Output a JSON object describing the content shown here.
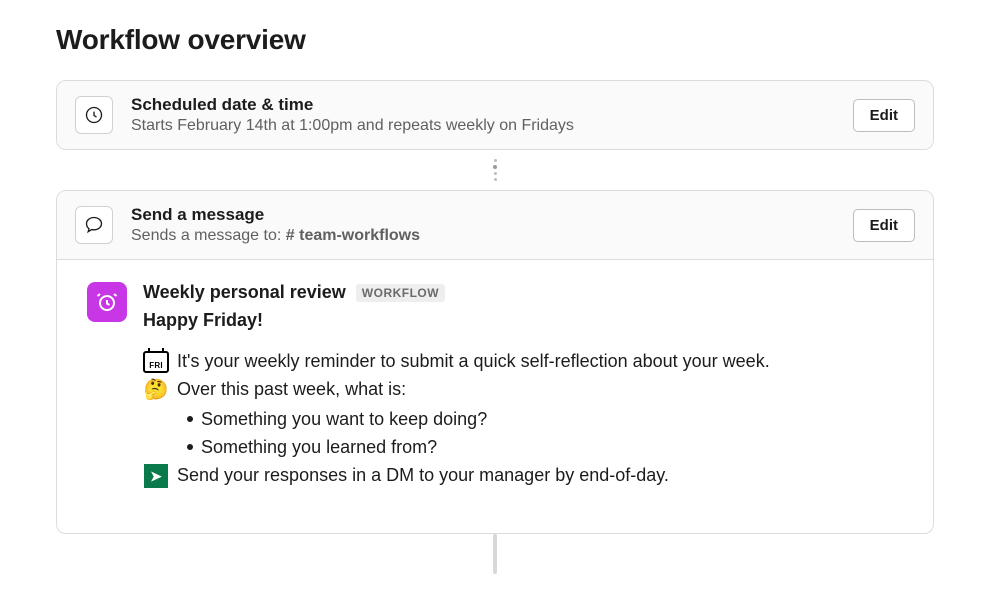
{
  "title": "Workflow overview",
  "steps": {
    "schedule": {
      "title": "Scheduled date & time",
      "subtitle": "Starts February 14th at 1:00pm and repeats weekly on Fridays",
      "edit_label": "Edit"
    },
    "send_message": {
      "title": "Send a message",
      "subtitle_prefix": "Sends a message to:  ",
      "channel": "# team-workflows",
      "edit_label": "Edit"
    }
  },
  "message": {
    "bot_name": "Weekly personal review",
    "bot_badge": "WORKFLOW",
    "greeting": "Happy Friday!",
    "fri_label": "FRI",
    "line_reminder": "It's your weekly reminder to submit a quick self-reflection about your week.",
    "line_prompt": "Over this past week, what is:",
    "bullets": [
      "Something you want to keep doing?",
      "Something you learned from?"
    ],
    "line_send": "Send your responses in a DM to your manager by end-of-day.",
    "arrow_glyph": "➤"
  },
  "icons": {
    "clock": "clock-icon",
    "chat": "chat-bubble-icon",
    "alarm": "alarm-clock-icon"
  }
}
